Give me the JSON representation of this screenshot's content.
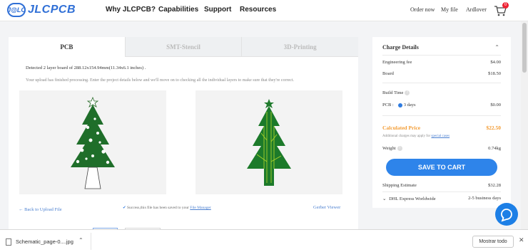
{
  "header": {
    "logo_badge": "J@LC",
    "logo_text": "JLCPCB",
    "nav": [
      "Why JLCPCB?",
      "Capabilities",
      "Support",
      "Resources"
    ],
    "order_now": "Order now",
    "my_file": "My file",
    "username": "Ardlover",
    "cart_count": "0"
  },
  "main": {
    "tabs": [
      "PCB",
      "SMT-Stencil",
      "3D-Printing"
    ],
    "detected": "Detected 2 layer board of 288.12x154.94mm(11.34x6.1 inches) .",
    "upload_message": "Your upload has finished processing. Enter the project details below and we'll move on to checking all the individual layers to make sure that they're correct.",
    "back_link": "Back to Upload File",
    "saved_prefix": "Success,this file has been saved to your",
    "file_manager": "File Manager",
    "gerber_viewer": "Gerber Viewer"
  },
  "charge": {
    "title": "Charge Details",
    "engineering_fee_label": "Engineering fee",
    "engineering_fee": "$4.00",
    "board_label": "Board",
    "board": "$18.50",
    "build_time_label": "Build Time",
    "pcb_label": "PCB :",
    "pcb_days": "3 days",
    "pcb_price": "$0.00",
    "calculated_label": "Calculated Price",
    "calculated_price": "$22.50",
    "additional_prefix": "Additional charges may apply for",
    "special_cases": "special cases",
    "weight_label": "Weight",
    "weight": "0.74kg",
    "save_to_cart": "SAVE TO CART",
    "shipping_label": "Shipping Estimate",
    "shipping_price": "$32.28",
    "carrier": "DHL Express Worldwide",
    "carrier_time": "2-5 business days"
  },
  "download": {
    "filename": "Schematic_page-0....jpg",
    "show_all": "Mostrar todo"
  },
  "colors": {
    "brand": "#2f6fd6",
    "accent_button": "#2e84ea",
    "price_orange": "#f39c34",
    "tree_green": "#1f7a2c",
    "trace_green": "#a8d12a"
  }
}
